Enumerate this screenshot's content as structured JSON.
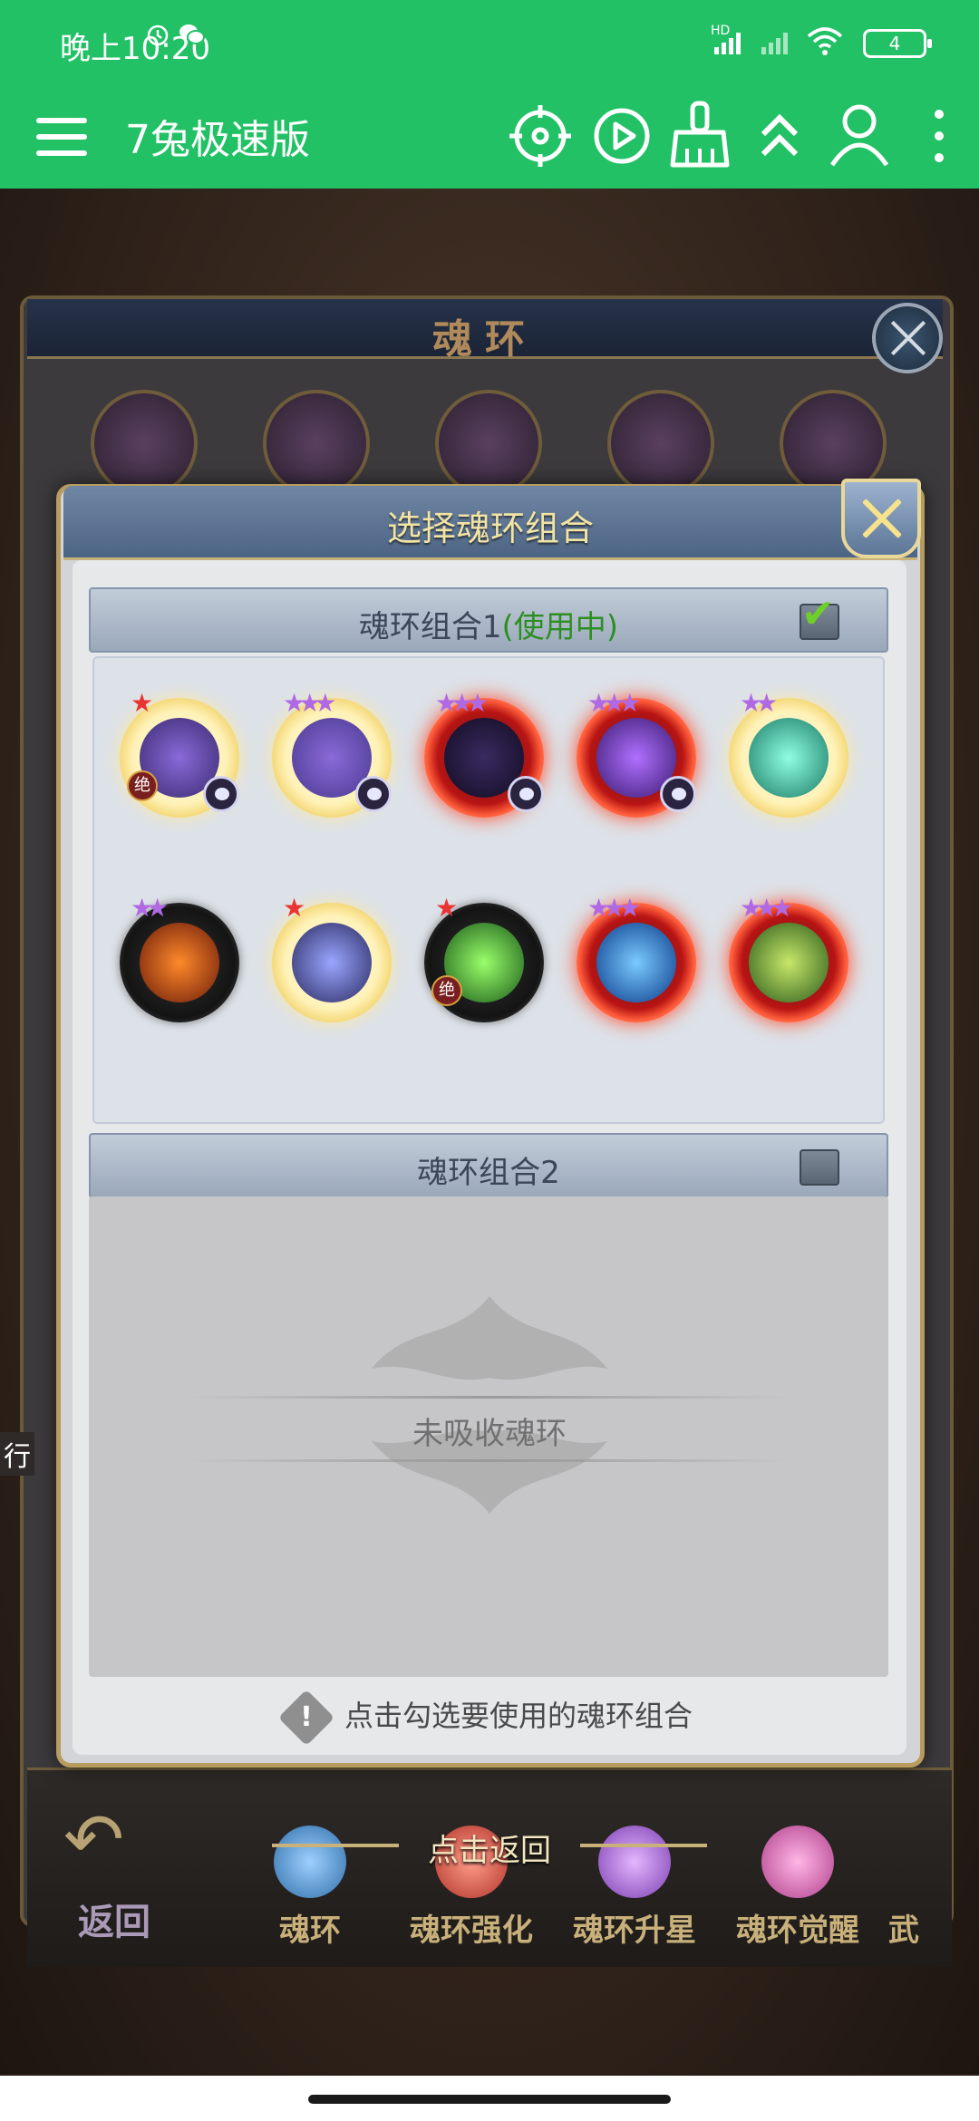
{
  "status_bar": {
    "time": "晚上10:20",
    "signal_label": "HD",
    "battery": "4"
  },
  "app_bar": {
    "title": "7兔极速版",
    "icons": [
      "menu-icon",
      "crosshair-icon",
      "play-icon",
      "broom-icon",
      "double-chevron-up-icon",
      "user-icon",
      "more-vertical-icon"
    ]
  },
  "background_panel": {
    "title": "魂环"
  },
  "modal": {
    "title": "选择魂环组合",
    "group1": {
      "label": "魂环组合1",
      "status": "(使用中)",
      "checked": true,
      "rings": [
        {
          "stars": "★",
          "star_color": "red",
          "glow": "white",
          "badge": "绝",
          "skull": true
        },
        {
          "stars": "★★★",
          "star_color": "purple",
          "glow": "white",
          "badge": "",
          "skull": true
        },
        {
          "stars": "★★★",
          "star_color": "purple",
          "glow": "red",
          "badge": "",
          "skull": true
        },
        {
          "stars": "★★★",
          "star_color": "purple",
          "glow": "red",
          "badge": "",
          "skull": true
        },
        {
          "stars": "★★",
          "star_color": "purple",
          "glow": "white",
          "badge": "",
          "skull": false
        },
        {
          "stars": "★★",
          "star_color": "purple",
          "glow": "black",
          "badge": "",
          "skull": false
        },
        {
          "stars": "★",
          "star_color": "red",
          "glow": "white",
          "badge": "",
          "skull": false
        },
        {
          "stars": "★",
          "star_color": "red",
          "glow": "black",
          "badge": "绝",
          "skull": false
        },
        {
          "stars": "★★★",
          "star_color": "purple",
          "glow": "red",
          "badge": "",
          "skull": false
        },
        {
          "stars": "★★★",
          "star_color": "purple",
          "glow": "red",
          "badge": "",
          "skull": false
        }
      ]
    },
    "group2": {
      "label": "魂环组合2",
      "checked": false,
      "empty_text": "未吸收魂环"
    },
    "hint": "点击勾选要使用的魂环组合",
    "hint_icon": "!"
  },
  "game_nav": {
    "back": "返回",
    "tap_return": "点击返回",
    "items": [
      "魂环",
      "魂环强化",
      "魂环升星",
      "魂环觉醒",
      "武"
    ]
  },
  "side_text": "行",
  "colors": {
    "app_bar": "#22c166",
    "in_use": "#2d8f22",
    "modal_title": "#f3e4a4"
  }
}
